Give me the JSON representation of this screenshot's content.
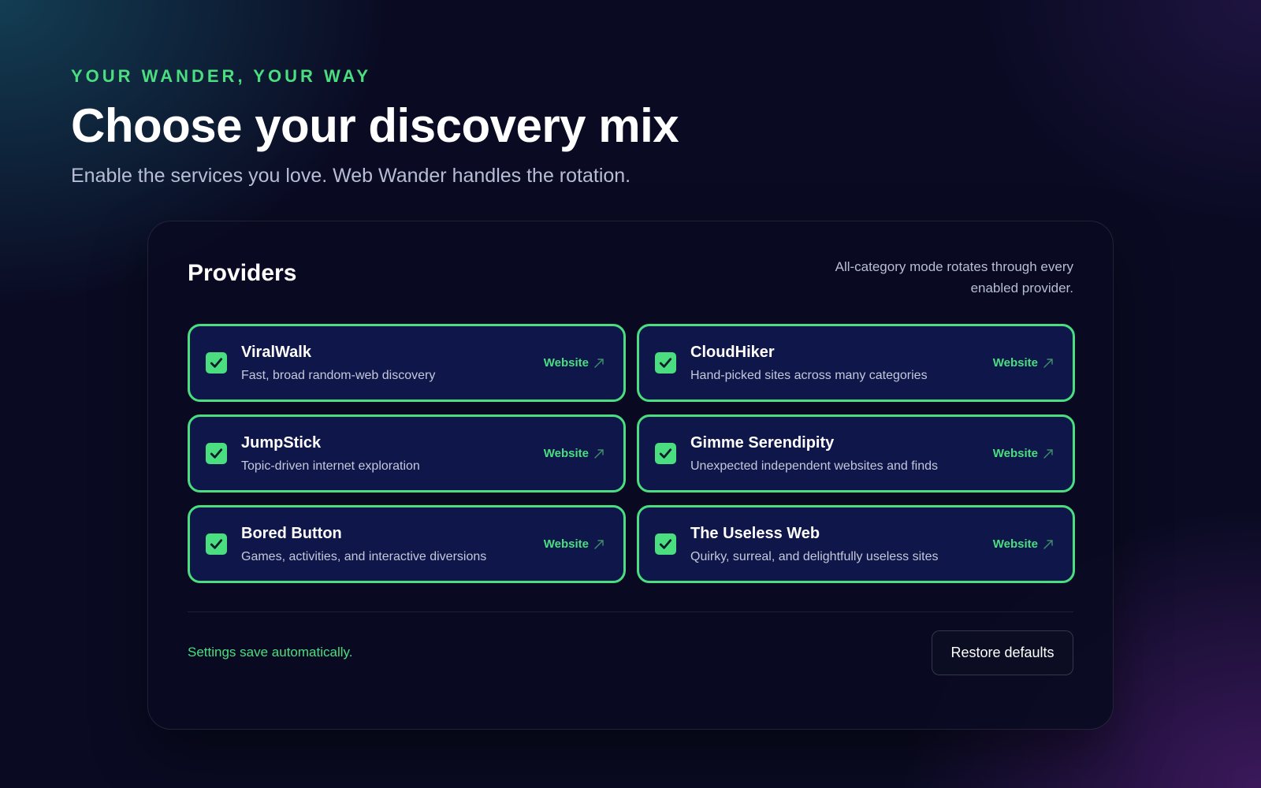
{
  "hero": {
    "eyebrow": "YOUR WANDER, YOUR WAY",
    "title": "Choose your discovery mix",
    "subtitle": "Enable the services you love. Web Wander handles the rotation."
  },
  "card": {
    "title": "Providers",
    "note": "All-category mode rotates through every enabled provider."
  },
  "providers": [
    {
      "name": "ViralWalk",
      "description": "Fast, broad random-web discovery",
      "link_label": "Website",
      "enabled": true
    },
    {
      "name": "CloudHiker",
      "description": "Hand-picked sites across many categories",
      "link_label": "Website",
      "enabled": true
    },
    {
      "name": "JumpStick",
      "description": "Topic-driven internet exploration",
      "link_label": "Website",
      "enabled": true
    },
    {
      "name": "Gimme Serendipity",
      "description": "Unexpected independent websites and finds",
      "link_label": "Website",
      "enabled": true
    },
    {
      "name": "Bored Button",
      "description": "Games, activities, and interactive diversions",
      "link_label": "Website",
      "enabled": true
    },
    {
      "name": "The Useless Web",
      "description": "Quirky, surreal, and delightfully useless sites",
      "link_label": "Website",
      "enabled": true
    }
  ],
  "footer": {
    "autosave_text": "Settings save automatically.",
    "restore_label": "Restore defaults"
  },
  "colors": {
    "accent": "#4ade80",
    "card_background": "#0f174a",
    "page_background": "#0a0b23"
  },
  "icons": {
    "checkbox": "checkmark-icon",
    "external_link": "external-link-arrow-icon"
  }
}
